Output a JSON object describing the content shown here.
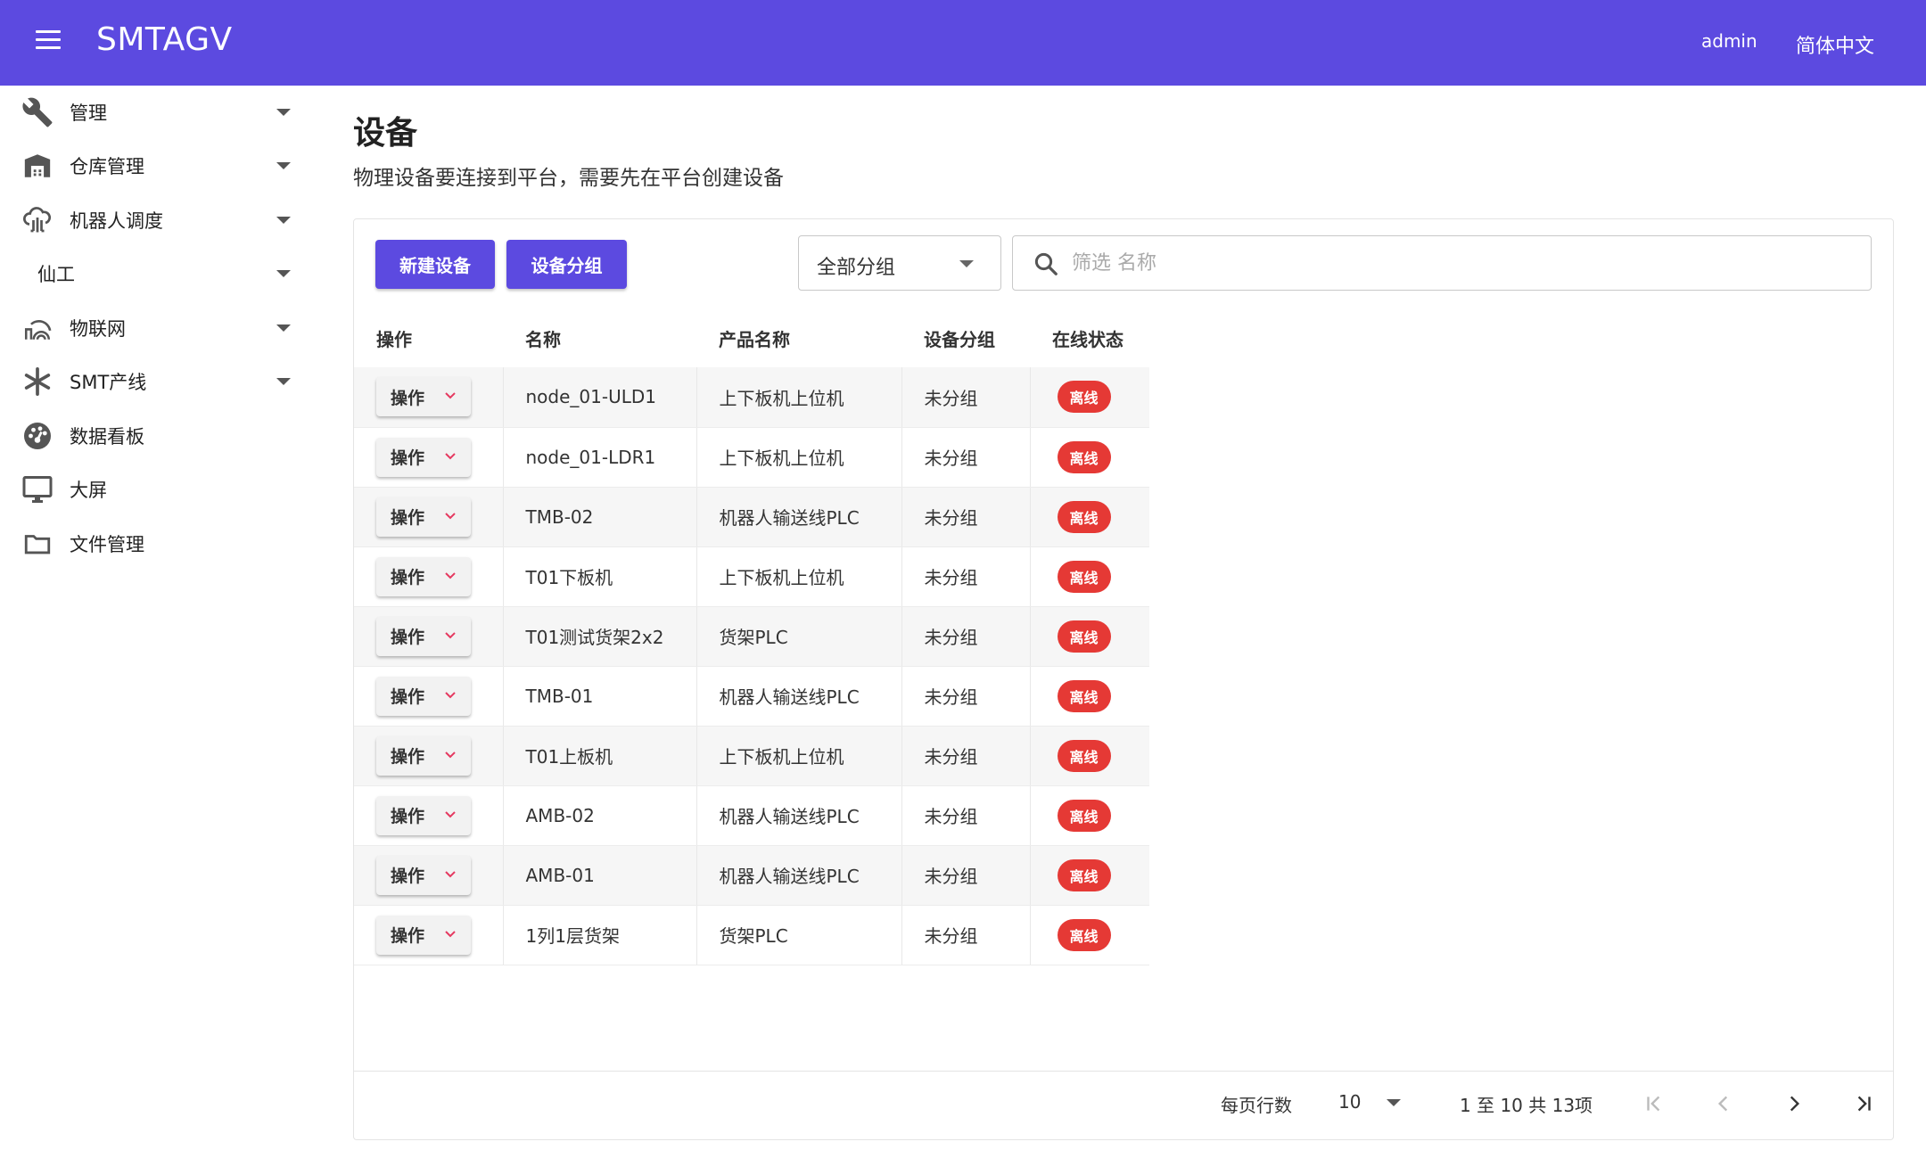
{
  "app": {
    "title": "SMTAGV",
    "user": "admin",
    "language": "简体中文"
  },
  "sidebar": {
    "items": [
      {
        "label": "管理",
        "icon": "wrench-icon",
        "expandable": true
      },
      {
        "label": "仓库管理",
        "icon": "warehouse-icon",
        "expandable": true
      },
      {
        "label": "机器人调度",
        "icon": "cloud-robot-icon",
        "expandable": true
      },
      {
        "label": "仙工",
        "icon": "",
        "expandable": true
      },
      {
        "label": "物联网",
        "icon": "iot-icon",
        "expandable": true
      },
      {
        "label": "SMT产线",
        "icon": "asterisk-icon",
        "expandable": true
      },
      {
        "label": "数据看板",
        "icon": "dashboard-icon",
        "expandable": false
      },
      {
        "label": "大屏",
        "icon": "monitor-icon",
        "expandable": false
      },
      {
        "label": "文件管理",
        "icon": "folder-icon",
        "expandable": false
      }
    ]
  },
  "page": {
    "title": "设备",
    "subtitle": "物理设备要连接到平台，需要先在平台创建设备"
  },
  "toolbar": {
    "new_device": "新建设备",
    "device_group": "设备分组",
    "group_select": "全部分组",
    "search_placeholder": "筛选 名称"
  },
  "table": {
    "headers": {
      "op": "操作",
      "name": "名称",
      "product": "产品名称",
      "group": "设备分组",
      "status": "在线状态"
    },
    "op_label": "操作",
    "rows": [
      {
        "name": "node_01-ULD1",
        "product": "上下板机上位机",
        "group": "未分组",
        "status": "离线"
      },
      {
        "name": "node_01-LDR1",
        "product": "上下板机上位机",
        "group": "未分组",
        "status": "离线"
      },
      {
        "name": "TMB-02",
        "product": "机器人输送线PLC",
        "group": "未分组",
        "status": "离线"
      },
      {
        "name": "T01下板机",
        "product": "上下板机上位机",
        "group": "未分组",
        "status": "离线"
      },
      {
        "name": "T01测试货架2x2",
        "product": "货架PLC",
        "group": "未分组",
        "status": "离线"
      },
      {
        "name": "TMB-01",
        "product": "机器人输送线PLC",
        "group": "未分组",
        "status": "离线"
      },
      {
        "name": "T01上板机",
        "product": "上下板机上位机",
        "group": "未分组",
        "status": "离线"
      },
      {
        "name": "AMB-02",
        "product": "机器人输送线PLC",
        "group": "未分组",
        "status": "离线"
      },
      {
        "name": "AMB-01",
        "product": "机器人输送线PLC",
        "group": "未分组",
        "status": "离线"
      },
      {
        "name": "1列1层货架",
        "product": "货架PLC",
        "group": "未分组",
        "status": "离线"
      }
    ]
  },
  "pagination": {
    "rows_per_page_label": "每页行数",
    "rows_per_page": "10",
    "range": "1 至 10 共 13项"
  },
  "colors": {
    "primary": "#5c4ae0",
    "offline": "#e53935"
  }
}
